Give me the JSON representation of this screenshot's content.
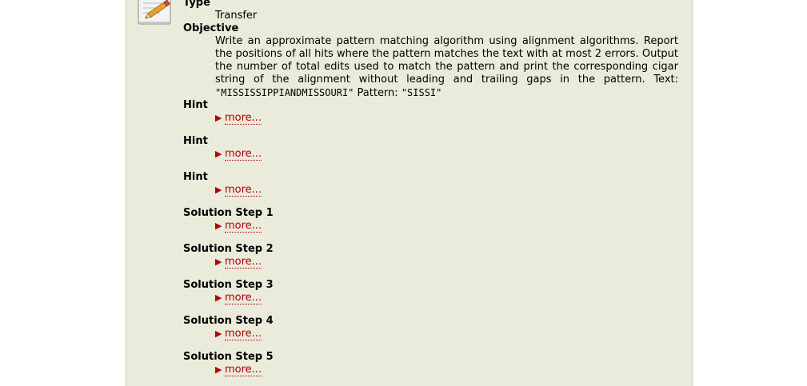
{
  "sections": {
    "type_label": "Type",
    "type_value": "Transfer",
    "objective_label": "Objective",
    "objective_text_1": "Write an approximate pattern matching algorithm using alignment algorithms. Report the positions of all hits where the pattern matches the text with at most 2 errors. Output the number of total edits used to match the pattern and print the corresponding cigar string of the alignment without leading and trailing gaps in the pattern. Text: ",
    "objective_text_code_1": "\"MISSISSIPPIANDMISSOURI\"",
    "objective_text_2": " Pattern: ",
    "objective_text_code_2": "\"SISSI\""
  },
  "expandables": [
    {
      "label": "Hint",
      "link": "more..."
    },
    {
      "label": "Hint",
      "link": "more..."
    },
    {
      "label": "Hint",
      "link": "more..."
    },
    {
      "label": "Solution Step 1",
      "link": "more..."
    },
    {
      "label": "Solution Step 2",
      "link": "more..."
    },
    {
      "label": "Solution Step 3",
      "link": "more..."
    },
    {
      "label": "Solution Step 4",
      "link": "more..."
    },
    {
      "label": "Solution Step 5",
      "link": "more..."
    }
  ],
  "icons": {
    "document_icon": "document-edit-icon",
    "expand_icon": "triangle-right-icon"
  },
  "colors": {
    "panel_background": "#ebebdb",
    "link": "#b30000"
  }
}
